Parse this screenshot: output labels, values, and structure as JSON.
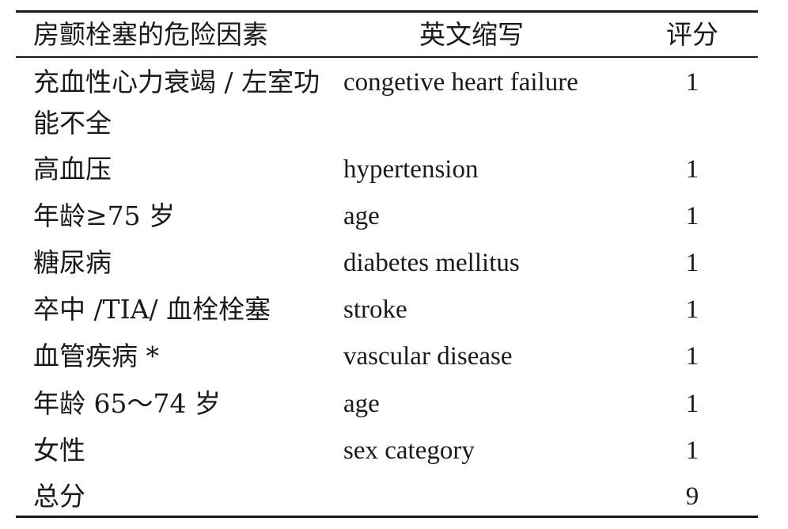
{
  "header": {
    "col1": "房颤栓塞的危险因素",
    "col2": "英文缩写",
    "col3": "评分"
  },
  "rows": [
    {
      "factor": "充血性心力衰竭 / 左室功能不全",
      "abbr": "congetive heart failure",
      "score": "1"
    },
    {
      "factor": "高血压",
      "abbr": "hypertension",
      "score": "1"
    },
    {
      "factor": "年龄≥75 岁",
      "abbr": "age",
      "score": "1"
    },
    {
      "factor": "糖尿病",
      "abbr": "diabetes mellitus",
      "score": "1"
    },
    {
      "factor": "卒中 /TIA/ 血栓栓塞",
      "abbr": "stroke",
      "score": "1"
    },
    {
      "factor": "血管疾病 *",
      "abbr": "vascular disease",
      "score": "1"
    },
    {
      "factor": "年龄 65～74 岁",
      "abbr": "age",
      "score": "1"
    },
    {
      "factor": "女性",
      "abbr": "sex category",
      "score": "1"
    },
    {
      "factor": "总分",
      "abbr": "",
      "score": "9"
    }
  ]
}
